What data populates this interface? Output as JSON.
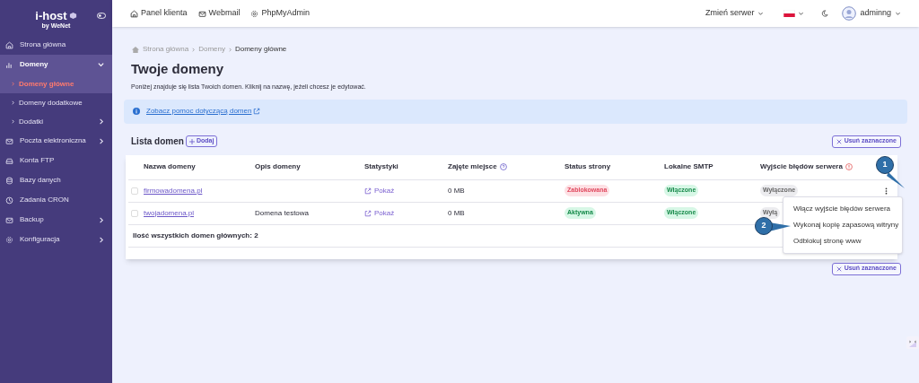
{
  "logo": {
    "name": "i-host",
    "tagline": "by WeNet"
  },
  "sidebar": {
    "items": [
      {
        "label": "Strona główna",
        "selected": false,
        "expandable": false
      },
      {
        "label": "Domeny",
        "selected": true,
        "expandable": true,
        "expanded": true,
        "children": [
          {
            "label": "Domeny główne",
            "selected": true,
            "expandable": false
          },
          {
            "label": "Domeny dodatkowe",
            "selected": false,
            "expandable": false
          },
          {
            "label": "Dodatki",
            "selected": false,
            "expandable": true
          }
        ]
      },
      {
        "label": "Poczta elektroniczna",
        "selected": false,
        "expandable": true
      },
      {
        "label": "Konta FTP",
        "selected": false,
        "expandable": false
      },
      {
        "label": "Bazy danych",
        "selected": false,
        "expandable": false
      },
      {
        "label": "Zadania CRON",
        "selected": false,
        "expandable": false
      },
      {
        "label": "Backup",
        "selected": false,
        "expandable": true
      },
      {
        "label": "Konfiguracja",
        "selected": false,
        "expandable": true
      }
    ]
  },
  "topbar": {
    "links": [
      {
        "label": "Panel klienta"
      },
      {
        "label": "Webmail"
      },
      {
        "label": "PhpMyAdmin"
      }
    ],
    "server_menu": "Zmień serwer",
    "user": "adminng"
  },
  "breadcrumb": [
    "Strona główna",
    "Domeny",
    "Domeny główne"
  ],
  "title": "Twoje domeny",
  "description": "Poniżej znajduje się lista Twoich domen. Kliknij na nazwę, jeżeli chcesz je edytować.",
  "info_link": "Zobacz pomoc dotyczącą domen",
  "list": {
    "title": "Lista domen",
    "add_button": "Dodaj",
    "delete_button_top": "Usuń zaznaczone",
    "delete_button_bottom": "Usuń zaznaczone",
    "columns": [
      "Nazwa domeny",
      "Opis domeny",
      "Statystyki",
      "Zajęte miejsce",
      "Status strony",
      "Lokalne SMTP",
      "Wyjście błędów serwera"
    ],
    "rows": [
      {
        "checked": false,
        "name": "firmowadomena.pl",
        "stats": "Pokaż",
        "space": "0 MB",
        "status": {
          "label": "Zablokowana",
          "kind": "red"
        },
        "smtp": {
          "label": "Włączone",
          "kind": "green"
        },
        "errors": {
          "label": "Wyłączone",
          "kind": "gray"
        }
      },
      {
        "checked": false,
        "name": "twojadomena.pl",
        "description": "Domena testowa",
        "stats": "Pokaż",
        "space": "0 MB",
        "status": {
          "label": "Aktywna",
          "kind": "green"
        },
        "smtp": {
          "label": "Włączone",
          "kind": "green"
        },
        "errors": {
          "label": "Wyłą",
          "kind": "gray"
        }
      }
    ],
    "footer": "Ilość wszystkich domen głównych: 2"
  },
  "context_menu": [
    "Włącz wyjście błędów serwera",
    "Wykonaj kopię zapasową witryny",
    "Odblokuj stronę www"
  ],
  "callouts": [
    "1",
    "2"
  ]
}
